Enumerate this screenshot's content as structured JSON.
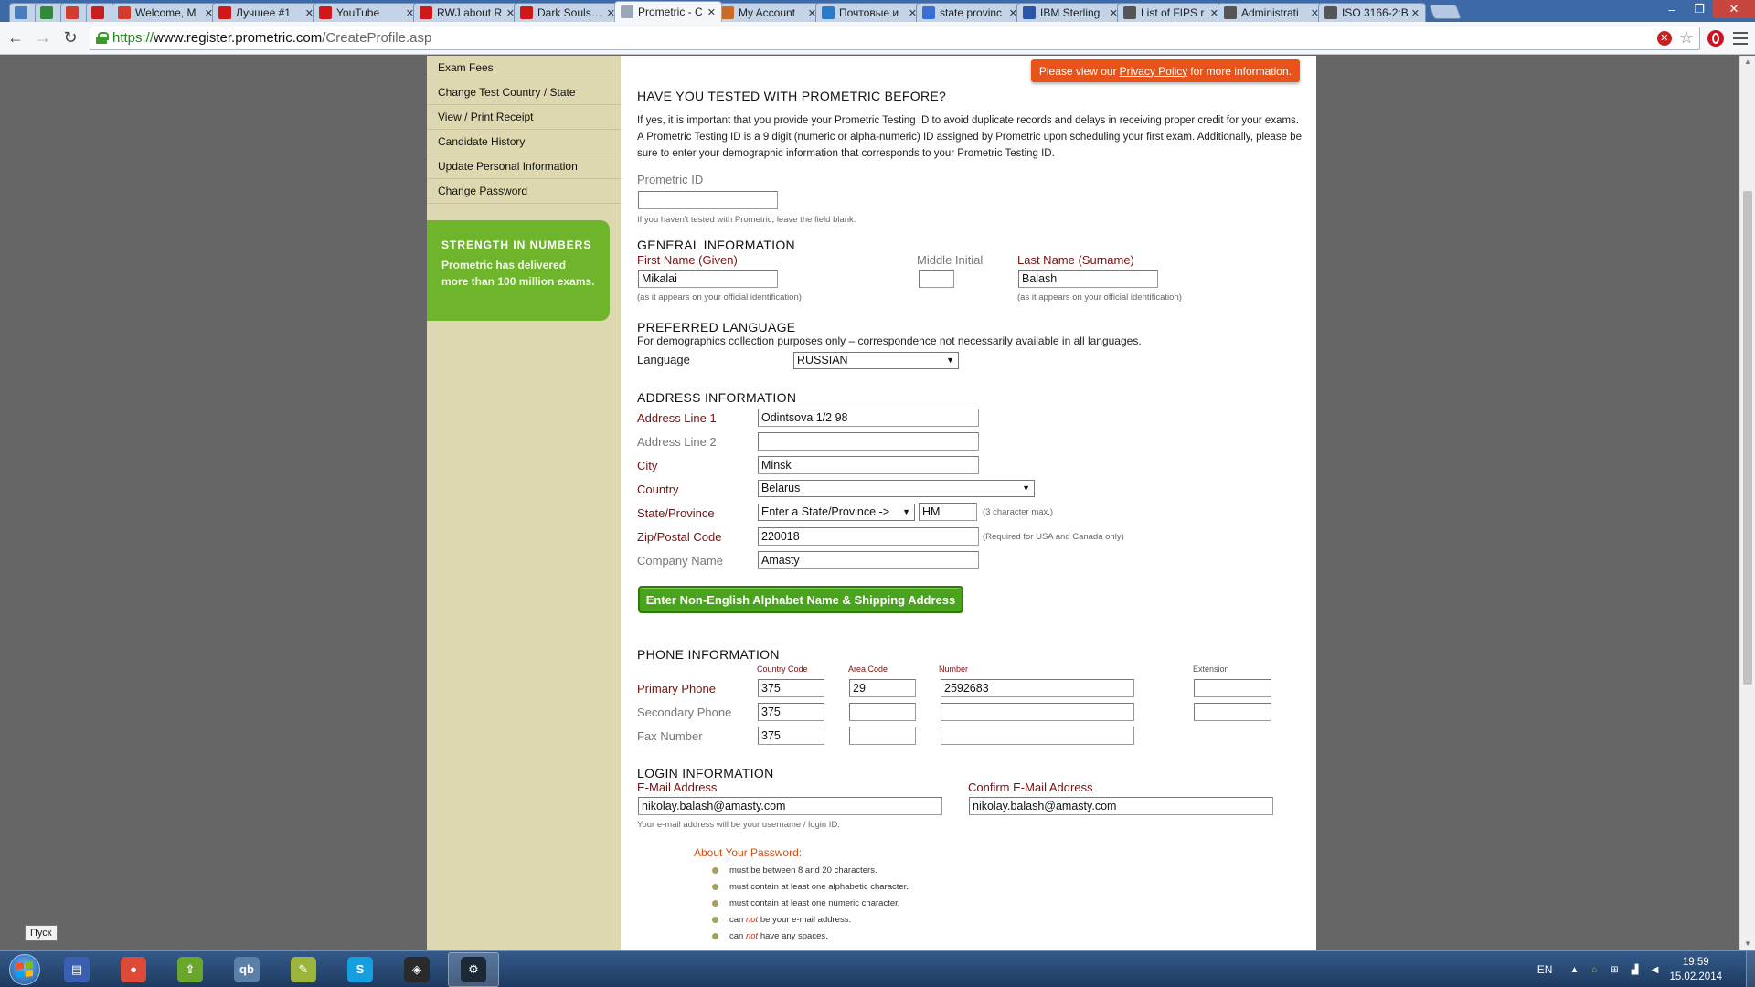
{
  "browser": {
    "tabs": [
      {
        "label": "",
        "favicon": "chat-icon",
        "color": "#4b7cc0",
        "small": true
      },
      {
        "label": "",
        "favicon": "tracker-icon",
        "color": "#2f8a3a",
        "small": true
      },
      {
        "label": "",
        "favicon": "gmail-icon",
        "color": "#d33b2c",
        "small": true
      },
      {
        "label": "",
        "favicon": "pdf-icon",
        "color": "#c81e1e",
        "small": true
      },
      {
        "label": "Welcome, M",
        "favicon": "gmail-icon",
        "color": "#d33b2c"
      },
      {
        "label": "Лучшее #1",
        "favicon": "youtube-icon",
        "color": "#d01818"
      },
      {
        "label": "YouTube",
        "favicon": "youtube-icon",
        "color": "#d01818"
      },
      {
        "label": "RWJ about R",
        "favicon": "youtube-icon",
        "color": "#d01818"
      },
      {
        "label": "Dark Souls: P",
        "favicon": "youtube-icon",
        "color": "#d01818"
      },
      {
        "label": "Prometric - C",
        "favicon": "page-icon",
        "color": "#9aa7b8",
        "active": true
      },
      {
        "label": "My Account",
        "favicon": "account-icon",
        "color": "#c86a2a"
      },
      {
        "label": "Почтовые и",
        "favicon": "mail-icon",
        "color": "#2a7ac8"
      },
      {
        "label": "state provinc",
        "favicon": "google-icon",
        "color": "#3a6fd8"
      },
      {
        "label": "IBM Sterling",
        "favicon": "ibm-icon",
        "color": "#2a55a8"
      },
      {
        "label": "List of FIPS r",
        "favicon": "wikipedia-icon",
        "color": "#555555"
      },
      {
        "label": "Administrati",
        "favicon": "wikipedia-icon",
        "color": "#555555"
      },
      {
        "label": "ISO 3166-2:B",
        "favicon": "wikipedia-icon",
        "color": "#555555"
      }
    ],
    "url": {
      "scheme": "https://",
      "host": "www.register.prometric.com",
      "path": "/CreateProfile.asp"
    }
  },
  "sidebar": {
    "links": [
      "Exam Fees",
      "Change Test Country / State",
      "View / Print Receipt",
      "Candidate History",
      "Update Personal Information",
      "Change Password"
    ],
    "promo_title": "STRENGTH IN NUMBERS",
    "promo_text": "Prometric has delivered more than 100 million exams."
  },
  "privacy": {
    "prefix": "Please view our",
    "link": "Privacy Policy",
    "suffix": "for more information."
  },
  "tested_before": {
    "heading": "HAVE YOU TESTED WITH PROMETRIC BEFORE?",
    "text": "If yes, it is important that you provide your Prometric Testing ID to avoid duplicate records and delays in receiving proper credit for your exams. A Prometric Testing ID is a 9 digit (numeric or alpha-numeric) ID assigned by Prometric upon scheduling your first exam. Additionally, please be sure to enter your demographic information that corresponds to your Prometric Testing ID.",
    "id_label": "Prometric ID",
    "id_value": "",
    "id_hint": "If you haven't tested with Prometric, leave the field blank."
  },
  "general": {
    "heading": "GENERAL INFORMATION",
    "first_label": "First Name (Given)",
    "first_value": "Mikalai",
    "first_hint": "(as it appears on your official identification)",
    "middle_label": "Middle Initial",
    "middle_value": "",
    "last_label": "Last Name (Surname)",
    "last_value": "Balash",
    "last_hint": "(as it appears on your official identification)"
  },
  "language": {
    "heading": "PREFERRED LANGUAGE",
    "note": "For demographics collection purposes only – correspondence not necessarily available in all languages.",
    "label": "Language",
    "value": "RUSSIAN"
  },
  "address": {
    "heading": "ADDRESS INFORMATION",
    "line1_label": "Address Line 1",
    "line1_value": "Odintsova 1/2 98",
    "line2_label": "Address Line 2",
    "line2_value": "",
    "city_label": "City",
    "city_value": "Minsk",
    "country_label": "Country",
    "country_value": "Belarus",
    "state_label": "State/Province",
    "state_select": "Enter a State/Province ->",
    "state_value": "HM",
    "state_hint": "(3 character max.)",
    "zip_label": "Zip/Postal Code",
    "zip_value": "220018",
    "zip_hint": "(Required for USA and Canada only)",
    "company_label": "Company Name",
    "company_value": "Amasty",
    "nonenglish_button": "Enter Non-English Alphabet Name & Shipping Address"
  },
  "phone": {
    "heading": "PHONE INFORMATION",
    "col_country": "Country Code",
    "col_area": "Area Code",
    "col_number": "Number",
    "col_ext": "Extension",
    "rows": [
      {
        "label": "Primary Phone",
        "country": "375",
        "area": "29",
        "number": "2592683",
        "ext": ""
      },
      {
        "label": "Secondary Phone",
        "country": "375",
        "area": "",
        "number": "",
        "ext": ""
      },
      {
        "label": "Fax Number",
        "country": "375",
        "area": "",
        "number": "",
        "ext": null
      }
    ]
  },
  "login": {
    "heading": "LOGIN INFORMATION",
    "email_label": "E-Mail Address",
    "email_value": "nikolay.balash@amasty.com",
    "email_hint": "Your e-mail address will be your username / login ID.",
    "confirm_label": "Confirm E-Mail Address",
    "confirm_value": "nikolay.balash@amasty.com"
  },
  "password": {
    "title": "About Your Password:",
    "rules": [
      {
        "pre": "must be between 8 and 20 characters.",
        "em": "",
        "post": ""
      },
      {
        "pre": "must contain at least one alphabetic character.",
        "em": "",
        "post": ""
      },
      {
        "pre": "must contain at least one numeric character.",
        "em": "",
        "post": ""
      },
      {
        "pre": "can ",
        "em": "not",
        "post": " be your e-mail address."
      },
      {
        "pre": "can ",
        "em": "not",
        "post": " have any spaces."
      }
    ]
  },
  "taskbar": {
    "start_tooltip": "Пуск",
    "apps": [
      {
        "name": "archive-icon",
        "color": "#3a5fb0",
        "glyph": "▤"
      },
      {
        "name": "chrome-icon",
        "color": "#dd4a38",
        "glyph": "●"
      },
      {
        "name": "skype-app-icon",
        "color": "#6aa62c",
        "glyph": "⇪"
      },
      {
        "name": "qbittorrent-icon",
        "color": "#5c7fa8",
        "glyph": "qb"
      },
      {
        "name": "notepad-icon",
        "color": "#9ab53a",
        "glyph": "✎"
      },
      {
        "name": "skype-icon",
        "color": "#14a0e0",
        "glyph": "S"
      },
      {
        "name": "alienware-icon",
        "color": "#2a2a2a",
        "glyph": "◈"
      },
      {
        "name": "steam-icon",
        "color": "#1a2838",
        "glyph": "⚙"
      }
    ],
    "lang": "EN",
    "time": "19:59",
    "date": "15.02.2014"
  }
}
